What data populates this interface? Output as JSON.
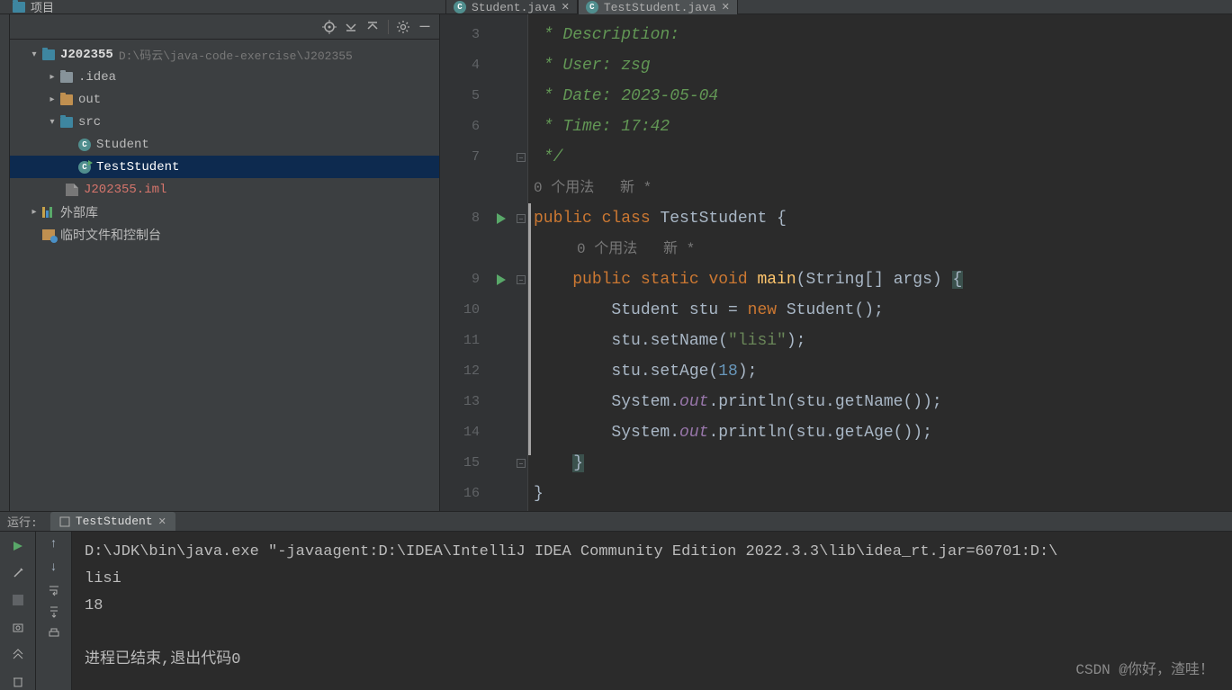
{
  "topbar": {
    "projectLabel": "项目"
  },
  "tabs": [
    {
      "label": "Student.java",
      "active": false
    },
    {
      "label": "TestStudent.java",
      "active": true
    }
  ],
  "project": {
    "root": {
      "name": "J202355",
      "path": "D:\\码云\\java-code-exercise\\J202355"
    },
    "idea": ".idea",
    "out": "out",
    "src": "src",
    "class1": "Student",
    "class2": "TestStudent",
    "iml": "J202355.iml",
    "libs": "外部库",
    "scratch": "临时文件和控制台"
  },
  "code": {
    "lines": {
      "3": " * Description:",
      "4": " * User: zsg",
      "5": " * Date: 2023-05-04",
      "6": " * Time: 17:42",
      "7": " */",
      "hint1_pre": "0 个用法",
      "hint1_post": "新 *",
      "8": "public class TestStudent {",
      "hint2_pre": "0 个用法",
      "hint2_post": "新 *",
      "9": "    public static void main(String[] args) {",
      "10": "        Student stu = new Student();",
      "11": "        stu.setName(\"lisi\");",
      "12": "        stu.setAge(18);",
      "13": "        System.out.println(stu.getName());",
      "14": "        System.out.println(stu.getAge());",
      "15": "    }",
      "16": "}"
    }
  },
  "run": {
    "tabsLabel": "运行:",
    "tabName": "TestStudent",
    "output": {
      "cmd": "D:\\JDK\\bin\\java.exe \"-javaagent:D:\\IDEA\\IntelliJ IDEA Community Edition 2022.3.3\\lib\\idea_rt.jar=60701:D:\\",
      "l1": "lisi",
      "l2": "18",
      "l3": "进程已结束,退出代码0"
    }
  },
  "watermark": "CSDN @你好，渣哇！"
}
